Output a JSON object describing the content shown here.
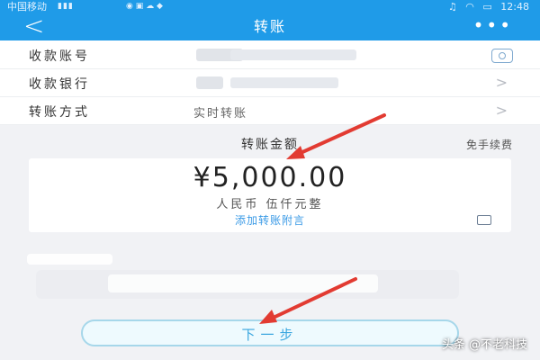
{
  "status_bar": {
    "carrier": "中国移动",
    "time": "12:48"
  },
  "nav": {
    "back_icon": "back-chevron",
    "title": "转账",
    "more_icon": "more-dots"
  },
  "form": {
    "account": {
      "label": "收款账号"
    },
    "bank": {
      "label": "收款银行"
    },
    "method": {
      "label": "转账方式",
      "value": "实时转账"
    }
  },
  "amount_section": {
    "label": "转账金额",
    "fee_note": "免手续费",
    "amount": "¥5,000.00",
    "amount_in_words": "人民币  伍仟元整",
    "memo_link": "添加转账附言"
  },
  "next_button": "下一步",
  "watermark": "头条 @不老科技",
  "colors": {
    "header": "#1f9be8",
    "accent": "#3aa6df",
    "annotation_arrow": "#e23b32"
  }
}
